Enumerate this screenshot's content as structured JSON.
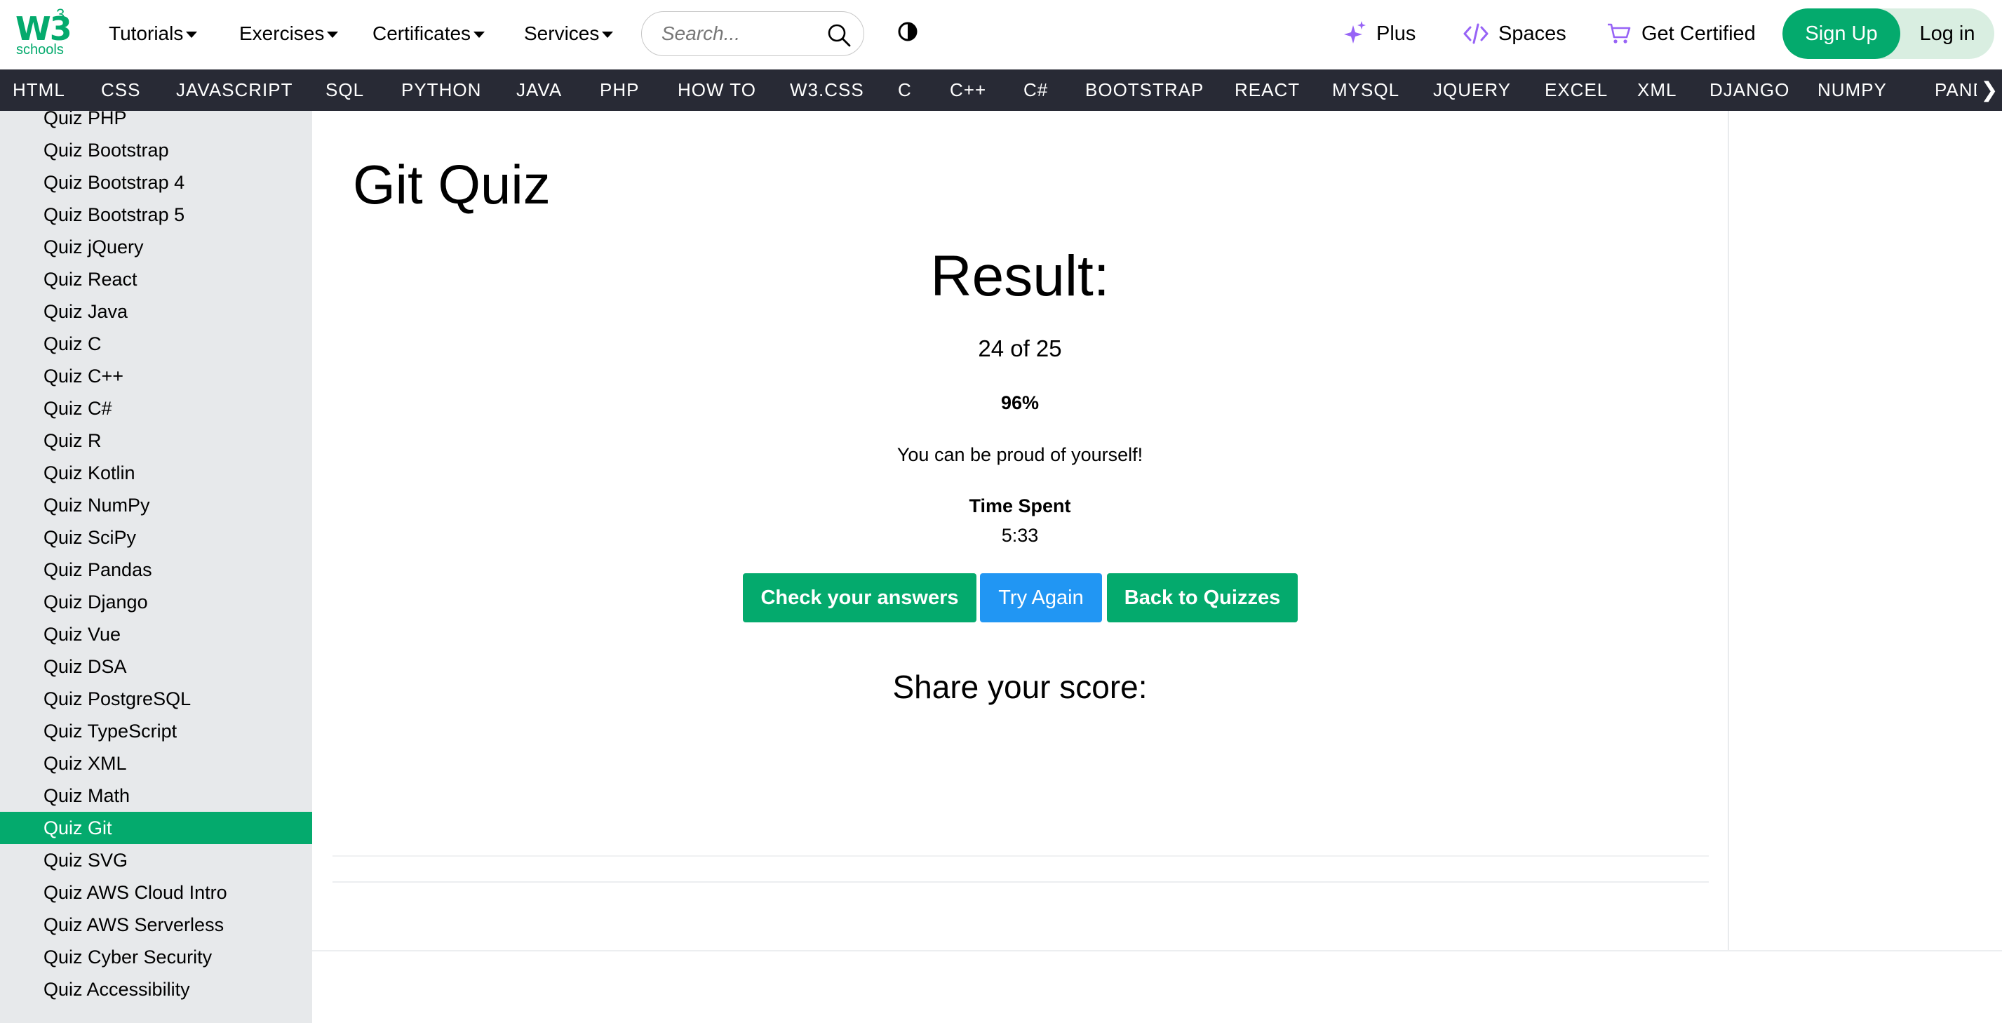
{
  "header": {
    "logo_main": "W3",
    "logo_sup": "3",
    "logo_sub": "schools",
    "nav": [
      {
        "label": "Tutorials"
      },
      {
        "label": "Exercises"
      },
      {
        "label": "Certificates"
      },
      {
        "label": "Services"
      }
    ],
    "search_placeholder": "Search...",
    "plus_label": "Plus",
    "spaces_label": "Spaces",
    "get_certified_label": "Get Certified",
    "signup_label": "Sign Up",
    "login_label": "Log in"
  },
  "subnav": [
    "HTML",
    "CSS",
    "JAVASCRIPT",
    "SQL",
    "PYTHON",
    "JAVA",
    "PHP",
    "HOW TO",
    "W3.CSS",
    "C",
    "C++",
    "C#",
    "BOOTSTRAP",
    "REACT",
    "MYSQL",
    "JQUERY",
    "EXCEL",
    "XML",
    "DJANGO",
    "NUMPY",
    "PANDAS"
  ],
  "sidebar": {
    "items": [
      "Quiz PHP",
      "Quiz Bootstrap",
      "Quiz Bootstrap 4",
      "Quiz Bootstrap 5",
      "Quiz jQuery",
      "Quiz React",
      "Quiz Java",
      "Quiz C",
      "Quiz C++",
      "Quiz C#",
      "Quiz R",
      "Quiz Kotlin",
      "Quiz NumPy",
      "Quiz SciPy",
      "Quiz Pandas",
      "Quiz Django",
      "Quiz Vue",
      "Quiz DSA",
      "Quiz PostgreSQL",
      "Quiz TypeScript",
      "Quiz XML",
      "Quiz Math",
      "Quiz Git",
      "Quiz SVG",
      "Quiz AWS Cloud Intro",
      "Quiz AWS Serverless",
      "Quiz Cyber Security",
      "Quiz Accessibility"
    ],
    "active": "Quiz Git"
  },
  "main": {
    "title": "Git Quiz",
    "result_heading": "Result:",
    "score": "24 of 25",
    "percent": "96%",
    "message": "You can be proud of yourself!",
    "time_label": "Time Spent",
    "time_value": "5:33",
    "buttons": {
      "check": "Check your answers",
      "try_again": "Try Again",
      "back": "Back to Quizzes"
    },
    "share_heading": "Share your score:"
  },
  "colors": {
    "brand_green": "#04AA6D",
    "subnav_bg": "#282A35",
    "sidebar_bg": "#E7E9EB",
    "try_again_blue": "#2196F3"
  }
}
